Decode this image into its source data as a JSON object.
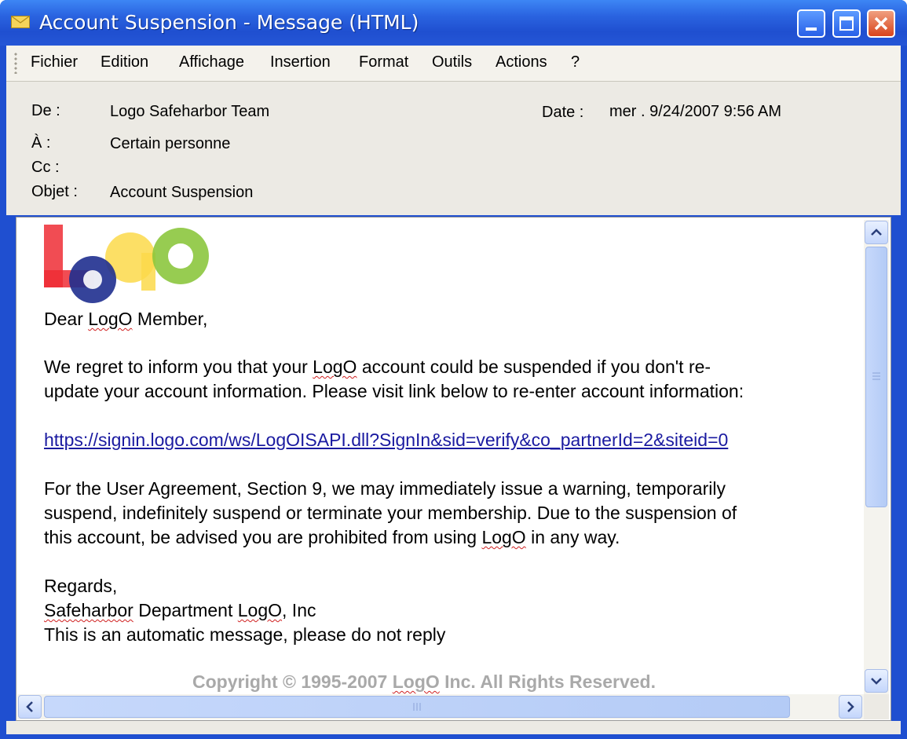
{
  "window": {
    "title": "Account Suspension - Message (HTML)"
  },
  "menu": {
    "items": [
      "Fichier",
      "Edition",
      "Affichage",
      "Insertion",
      "Format",
      "Outils",
      "Actions",
      "?"
    ]
  },
  "header": {
    "from_label": "De :",
    "from_value": "Logo Safeharbor Team",
    "to_label": "À :",
    "to_value": "Certain personne",
    "cc_label": "Cc :",
    "cc_value": "",
    "subject_label": "Objet :",
    "subject_value": "Account Suspension",
    "date_label": "Date :",
    "date_value": "mer . 9/24/2007 9:56 AM"
  },
  "message": {
    "logo_text": "LogO",
    "greeting_pre": "Dear ",
    "greeting_brand": "LogO",
    "greeting_post": " Member,",
    "para1_l1_pre": "We regret to inform you that your ",
    "para1_l1_brand": "LogO",
    "para1_l1_post": " account could be suspended if you don't re-",
    "para1_l2": "update your account information. Please visit link below to re-enter account information:",
    "link": "https://signin.logo.com/ws/LogOISAPI.dll?SignIn&sid=verify&co_partnerId=2&siteid=0",
    "para2_l1": "For the User Agreement, Section 9, we may immediately issue a warning, temporarily",
    "para2_l2": "suspend, indefinitely suspend or terminate your membership. Due to the suspension of",
    "para2_l3_pre": "this account, be advised you are prohibited from using ",
    "para2_l3_brand": "LogO",
    "para2_l3_post": " in any way.",
    "regards": "Regards,",
    "signature_dept": "Safeharbor",
    "signature_mid": " Department ",
    "signature_brand": "LogO",
    "signature_post": ", Inc",
    "auto_note": "This is an automatic message, please do not reply",
    "copyright_pre": "Copyright © 1995-2007 ",
    "copyright_brand": "LogO",
    "copyright_post": " Inc. All Rights Reserved."
  },
  "colors": {
    "titlebar": "#1f4fd0",
    "link": "#1a1aa0",
    "logo_red": "#ee2d35",
    "logo_yellow": "#fbd94a",
    "logo_green": "#8cc63e",
    "logo_blue": "#1f2f8f"
  }
}
